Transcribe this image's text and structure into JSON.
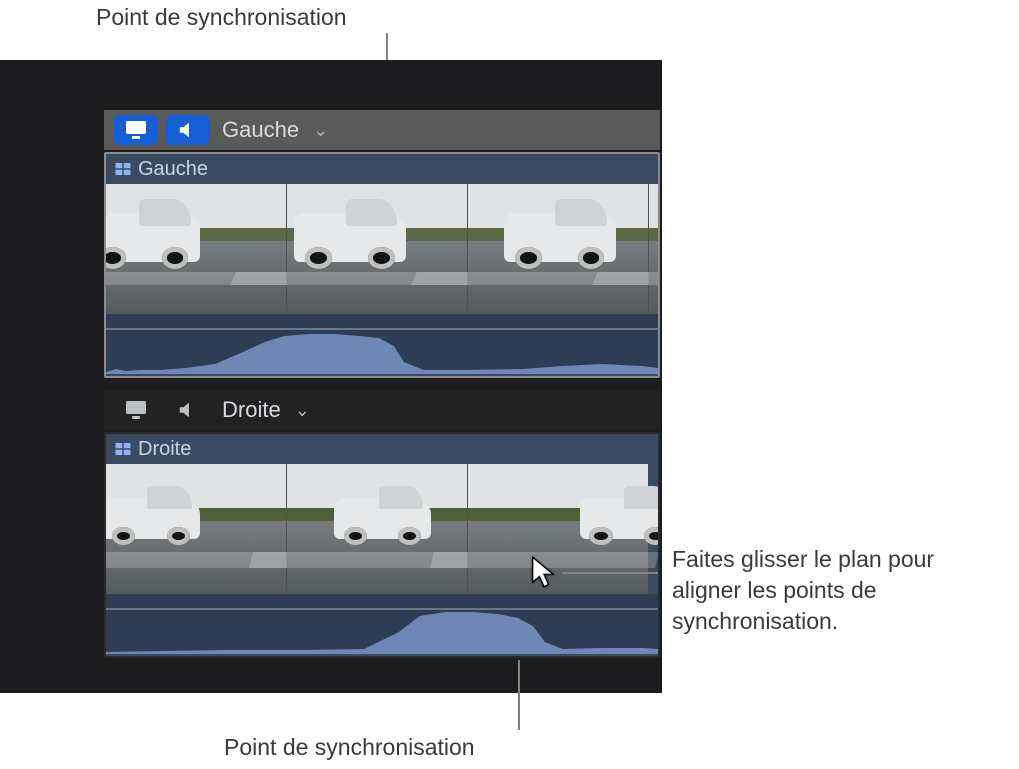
{
  "annotations": {
    "top": "Point de synchronisation",
    "bottom": "Point de synchronisation",
    "side": "Faites glisser le plan pour aligner les points de synchronisation."
  },
  "angles": {
    "a1": {
      "name": "Gauche",
      "clip_name": "Gauche"
    },
    "a2": {
      "name": "Droite",
      "clip_name": "Droite"
    }
  }
}
